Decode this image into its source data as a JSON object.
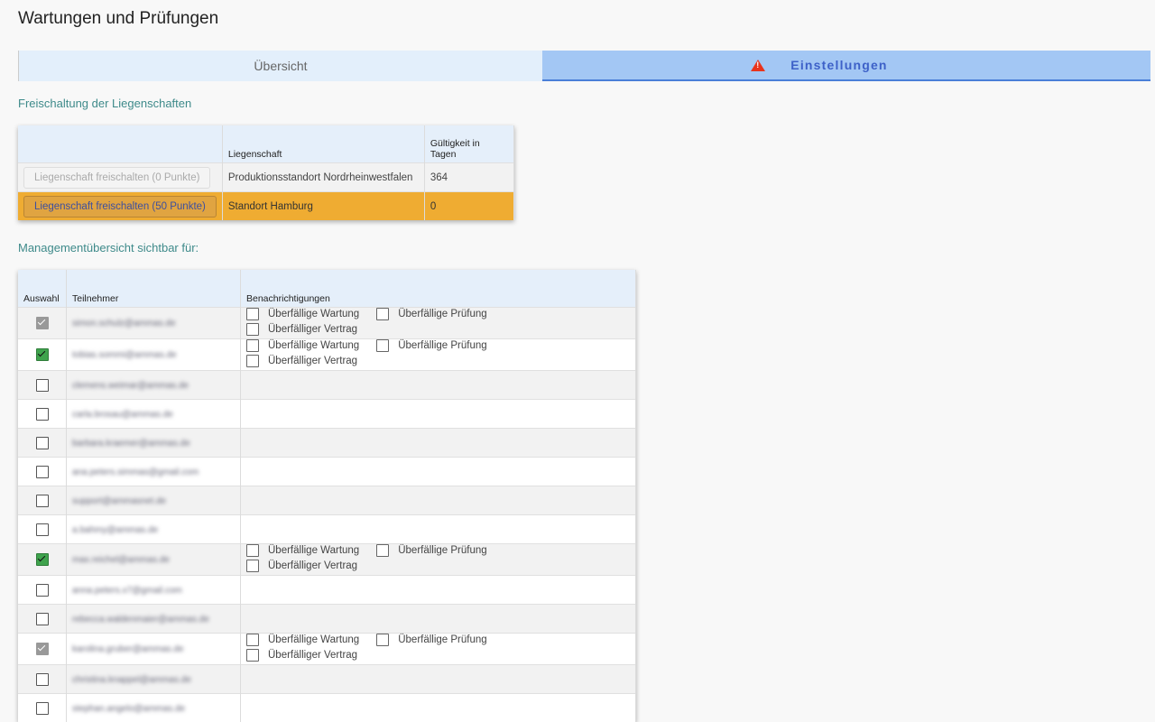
{
  "title": "Wartungen und Prüfungen",
  "tabs": {
    "overview": "Übersicht",
    "settings": "Einstellungen"
  },
  "colors": {
    "accent": "#3d61c8",
    "highlight": "#efac32",
    "warning": "#e8331c",
    "checked": "#3fa34d"
  },
  "section1": "Freischaltung der Liegenschaften",
  "properties": {
    "headers": [
      "",
      "Liegenschaft",
      "Gültigkeit in Tagen"
    ],
    "rows": [
      {
        "button": "Liegenschaft freischalten (0 Punkte)",
        "name": "Produktionsstandort Nordrheinwestfalen",
        "days": "364"
      },
      {
        "button": "Liegenschaft freischalten (50 Punkte)",
        "name": "Standort Hamburg",
        "days": "0"
      }
    ]
  },
  "section2": "Managementübersicht sichtbar für:",
  "participants": {
    "headers": [
      "Auswahl",
      "Teilnehmer",
      "Benachrichtigungen"
    ],
    "notif_labels": [
      "Überfällige Wartung",
      "Überfällige Prüfung",
      "Überfälliger Vertrag"
    ],
    "rows": [
      {
        "email": "simon.schulz@ammas.de",
        "state": "disabled",
        "notif": true
      },
      {
        "email": "tobias.sommi@ammas.de",
        "state": "checked",
        "notif": true
      },
      {
        "email": "clemens.weimar@ammas.de",
        "state": "unchecked",
        "notif": false
      },
      {
        "email": "carla.brosau@ammas.de",
        "state": "unchecked",
        "notif": false
      },
      {
        "email": "barbara.kraemer@ammas.de",
        "state": "unchecked",
        "notif": false
      },
      {
        "email": "ana.peters.simmas@gmail.com",
        "state": "unchecked",
        "notif": false
      },
      {
        "email": "support@ammasnet.de",
        "state": "unchecked",
        "notif": false
      },
      {
        "email": "a.bahmy@ammas.de",
        "state": "unchecked",
        "notif": false
      },
      {
        "email": "max.reichel@ammas.de",
        "state": "checked",
        "notif": true
      },
      {
        "email": "anna.peters.x7@gmail.com",
        "state": "unchecked",
        "notif": false
      },
      {
        "email": "rebecca.waldenmaier@ammas.de",
        "state": "unchecked",
        "notif": false
      },
      {
        "email": "karolina.gruber@ammas.de",
        "state": "disabled",
        "notif": true
      },
      {
        "email": "christina.knappel@ammas.de",
        "state": "unchecked",
        "notif": false
      },
      {
        "email": "stephan.angelo@ammas.de",
        "state": "unchecked",
        "notif": false
      }
    ]
  }
}
